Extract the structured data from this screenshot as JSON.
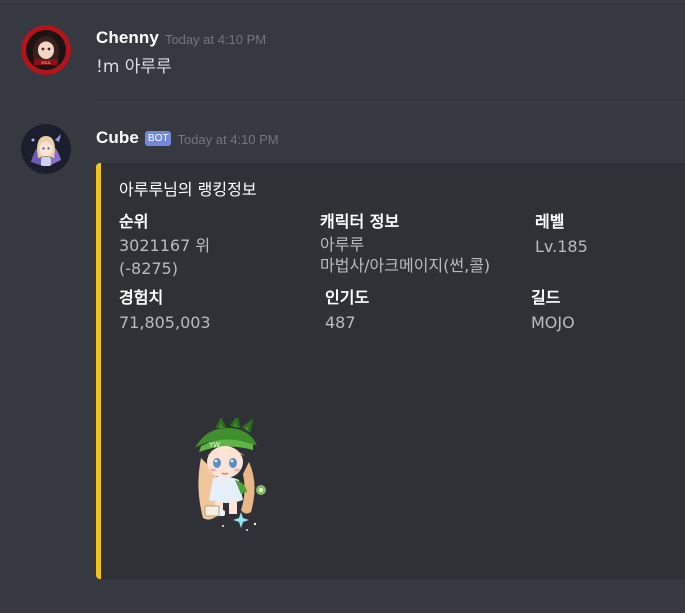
{
  "messages": [
    {
      "author": "Chenny",
      "timestamp": "Today at 4:10 PM",
      "content": "!m 아루루"
    },
    {
      "author": "Cube",
      "bot_tag": "BOT",
      "timestamp": "Today at 4:10 PM",
      "embed": {
        "accent_color": "#f3c517",
        "title": "아루루님의 랭킹정보",
        "fields": {
          "rank": {
            "name": "순위",
            "value_line1": "3021167 위",
            "value_line2": "(-8275)"
          },
          "character": {
            "name": "캐릭터 정보",
            "value_line1": "아루루",
            "value_line2": "마법사/아크메이지(썬,콜)"
          },
          "level": {
            "name": "레벨",
            "value": "Lv.185"
          },
          "exp": {
            "name": "경험치",
            "value": "71,805,003"
          },
          "fame": {
            "name": "인기도",
            "value": "487"
          },
          "guild": {
            "name": "길드",
            "value": "MOJO"
          }
        }
      }
    }
  ],
  "colors": {
    "background": "#36393f",
    "embed_background": "#2f3136",
    "bot_tag": "#7289da",
    "timestamp": "#72767d"
  }
}
